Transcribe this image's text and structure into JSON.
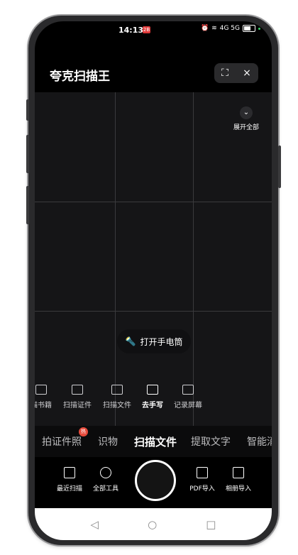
{
  "status": {
    "time": "14:13",
    "notif_badge": "2B",
    "network": "4G 5G"
  },
  "header": {
    "title": "夸克扫描王",
    "scan_icon": "scan-frame-icon",
    "close_icon": "×"
  },
  "camera": {
    "expand_label": "展开全部",
    "torch_label": "打开手电筒"
  },
  "mini_tools": [
    "描书籍",
    "扫描证件",
    "扫描文件",
    "去手写",
    "记录屏幕"
  ],
  "mini_tools_active": "去手写",
  "modes": {
    "items": [
      "拍证件照",
      "识物",
      "扫描文件",
      "提取文字",
      "智能消"
    ],
    "active": "扫描文件",
    "hot_label": "热"
  },
  "bottom": {
    "recent_scan": "最近扫描",
    "all_tools": "全部工具",
    "pdf_import": "PDF导入",
    "album_import": "相册导入"
  },
  "nav": {
    "back": "◁",
    "home": "○",
    "recent": "□"
  },
  "colors": {
    "accent_hot": "#e64b3c",
    "background": "#000000"
  }
}
